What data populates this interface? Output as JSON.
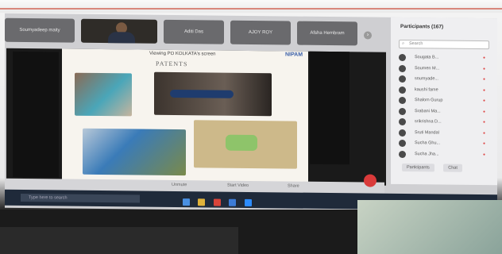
{
  "meeting": {
    "tiles": [
      {
        "label": "Soumyadeep maity"
      },
      {
        "label": ""
      },
      {
        "label": "Aditi Das"
      },
      {
        "label": "AJOY ROY"
      },
      {
        "label": "Afsha Hembram"
      }
    ],
    "share_banner": "Viewing PO KOLKATA's screen",
    "slide_logo": "NIPAM",
    "slide_title": "PATENTS",
    "controls": [
      "Unmute",
      "Start Video",
      "Share"
    ],
    "participants": {
      "title": "Participants (167)",
      "search_placeholder": "Search",
      "names": [
        "Sougata B...",
        "Soumen M...",
        "soumyade...",
        "kaushi fame",
        "Shalom Gurup",
        "Srabani Ma...",
        "srikrishna D...",
        "Sruti Mandal",
        "Sucha Ghu...",
        "Sucha Jha..."
      ],
      "buttons": [
        "Participants",
        "Chat"
      ]
    },
    "taskbar_search": "Type here to search"
  },
  "colors": {
    "end_call": "#d93a3a",
    "taskbar": "#1f2a3a",
    "logo": "#3a5fa8"
  }
}
